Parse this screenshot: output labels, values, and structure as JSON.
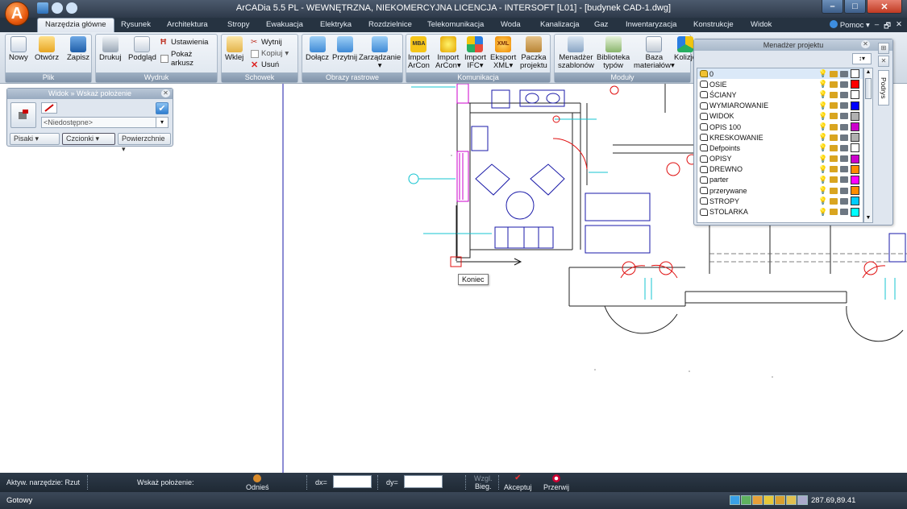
{
  "app": {
    "title": "ArCADia 5.5 PL - WEWNĘTRZNA, NIEKOMERCYJNA LICENCJA - INTERSOFT [L01] - [budynek CAD-1.dwg]",
    "logo_letter": "A"
  },
  "tabs": [
    "Narzędzia główne",
    "Rysunek",
    "Architektura",
    "Stropy",
    "Ewakuacja",
    "Elektryka",
    "Rozdzielnice",
    "Telekomunikacja",
    "Woda",
    "Kanalizacja",
    "Gaz",
    "Inwentaryzacja",
    "Konstrukcje",
    "Widok"
  ],
  "help": "Pomoc",
  "ribbon": {
    "plik": {
      "label": "Plik",
      "nowy": "Nowy",
      "otworz": "Otwórz",
      "zapisz": "Zapisz"
    },
    "wydruk": {
      "label": "Wydruk",
      "drukuj": "Drukuj",
      "podglad": "Podgląd",
      "ustawienia": "Ustawienia",
      "pokaz_arkusz": "Pokaż arkusz"
    },
    "schowek": {
      "label": "Schowek",
      "wklej": "Wklej",
      "wytnij": "Wytnij",
      "kopiuj": "Kopiuj",
      "usun": "Usuń"
    },
    "obrazy": {
      "label": "Obrazy rastrowe",
      "dolacz": "Dołącz",
      "przytnij": "Przytnij",
      "zarzadzanie": "Zarządzanie"
    },
    "komunikacja": {
      "label": "Komunikacja",
      "import_arcon_1": "Import",
      "import_arcon_1b": "ArCon",
      "import_arcon_2": "Import",
      "import_arcon_2b": "ArCon",
      "import_ifc": "Import",
      "import_ifcb": "IFC",
      "eksport_xml": "Eksport",
      "eksport_xmlb": "XML",
      "paczka": "Paczka",
      "paczkab": "projektu",
      "mba_tag": "MBA",
      "xml_tag": "XML"
    },
    "moduly": {
      "label": "Moduły",
      "menadzer": "Menadżer",
      "menadzerb": "szablonów",
      "biblioteka": "Biblioteka",
      "bibliotekab": "typów",
      "baza": "Baza",
      "bazab": "materiałów",
      "kolizje": "Kolizje"
    }
  },
  "view_panel": {
    "title": "Widok » Wskaż położenie",
    "field": "<Niedostępne>",
    "tabs": [
      "Pisaki",
      "Czcionki",
      "Powierzchnie"
    ]
  },
  "project_manager": {
    "title": "Menadżer projektu",
    "side_tab": "Podrys",
    "layers": [
      {
        "name": "0",
        "color": "#ffffff",
        "bulb": "yellow",
        "current": true
      },
      {
        "name": "OSIE",
        "color": "#ff0000",
        "bulb": "blue"
      },
      {
        "name": "ŚCIANY",
        "color": "#ffffff",
        "bulb": "yellow"
      },
      {
        "name": "WYMIAROWANIE",
        "color": "#0000ff",
        "bulb": "blue"
      },
      {
        "name": "WIDOK",
        "color": "#b0b0b0",
        "bulb": "yellow"
      },
      {
        "name": "OPIS 100",
        "color": "#cc00cc",
        "bulb": "yellow"
      },
      {
        "name": "KRESKOWANIE",
        "color": "#b0b0b0",
        "bulb": "yellow"
      },
      {
        "name": "Defpoints",
        "color": "#ffffff",
        "bulb": "yellow"
      },
      {
        "name": "OPISY",
        "color": "#cc00cc",
        "bulb": "blue"
      },
      {
        "name": "DREWNO",
        "color": "#ff8c00",
        "bulb": "yellow"
      },
      {
        "name": "parter",
        "color": "#ff00ff",
        "bulb": "yellow"
      },
      {
        "name": "przerywane",
        "color": "#ff8c00",
        "bulb": "yellow"
      },
      {
        "name": "STROPY",
        "color": "#00ccff",
        "bulb": "yellow"
      },
      {
        "name": "STOLARKA",
        "color": "#00ffff",
        "bulb": "yellow"
      }
    ]
  },
  "canvas": {
    "tooltip": "Koniec"
  },
  "command_bar": {
    "tool": "Aktyw. narzędzie: Rzut",
    "prompt": "Wskaż położenie:",
    "odnies": "Odnieś",
    "dx_label": "dx=",
    "dy_label": "dy=",
    "wzgl": "Wzgl.",
    "bieg": "Bieg.",
    "akceptuj": "Akceptuj",
    "przerwij": "Przerwij"
  },
  "status": {
    "text": "Gotowy",
    "coords": "287.69,89.41"
  }
}
